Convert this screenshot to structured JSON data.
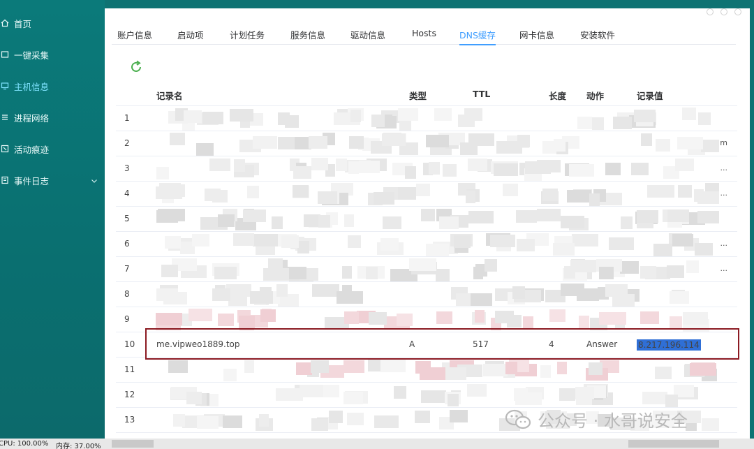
{
  "sidebar": {
    "items": [
      {
        "label": "首页",
        "icon": "home-icon"
      },
      {
        "label": "一键采集",
        "icon": "collect-icon"
      },
      {
        "label": "主机信息",
        "icon": "host-icon",
        "active": true
      },
      {
        "label": "进程网络",
        "icon": "process-icon"
      },
      {
        "label": "活动痕迹",
        "icon": "activity-icon"
      },
      {
        "label": "事件日志",
        "icon": "log-icon",
        "expandable": true
      }
    ]
  },
  "tabs": [
    {
      "label": "账户信息"
    },
    {
      "label": "启动项"
    },
    {
      "label": "计划任务"
    },
    {
      "label": "服务信息"
    },
    {
      "label": "驱动信息"
    },
    {
      "label": "Hosts"
    },
    {
      "label": "DNS缓存",
      "active": true
    },
    {
      "label": "网卡信息"
    },
    {
      "label": "安装软件"
    }
  ],
  "table": {
    "columns": [
      "记录名",
      "类型",
      "TTL",
      "长度",
      "动作",
      "记录值"
    ],
    "row_numbers": [
      "1",
      "2",
      "3",
      "4",
      "5",
      "6",
      "7",
      "8",
      "9",
      "10",
      "11",
      "12",
      "13"
    ],
    "ellipsis_marks": {
      "2": "m",
      "3": "...",
      "4": "...",
      "6": "...",
      "7": "..."
    },
    "visible_row": {
      "index": "10",
      "record_name": "me.vipweo1889.top",
      "type": "A",
      "ttl": "517",
      "length": "4",
      "action": "Answer",
      "value": "8.217.196.114"
    }
  },
  "watermark": {
    "text": "公众号 · 水哥说安全"
  },
  "statusbar": {
    "cpu": "CPU: 100.00%",
    "memory": "内存: 37.00%"
  },
  "colors": {
    "sidebar_bg": "#0b7a7a",
    "active_tab": "#409eff",
    "active_nav": "#7fe3ff",
    "highlight_border": "#8b1a22",
    "selection": "#2f6fd6",
    "refresh": "#4caf50"
  }
}
